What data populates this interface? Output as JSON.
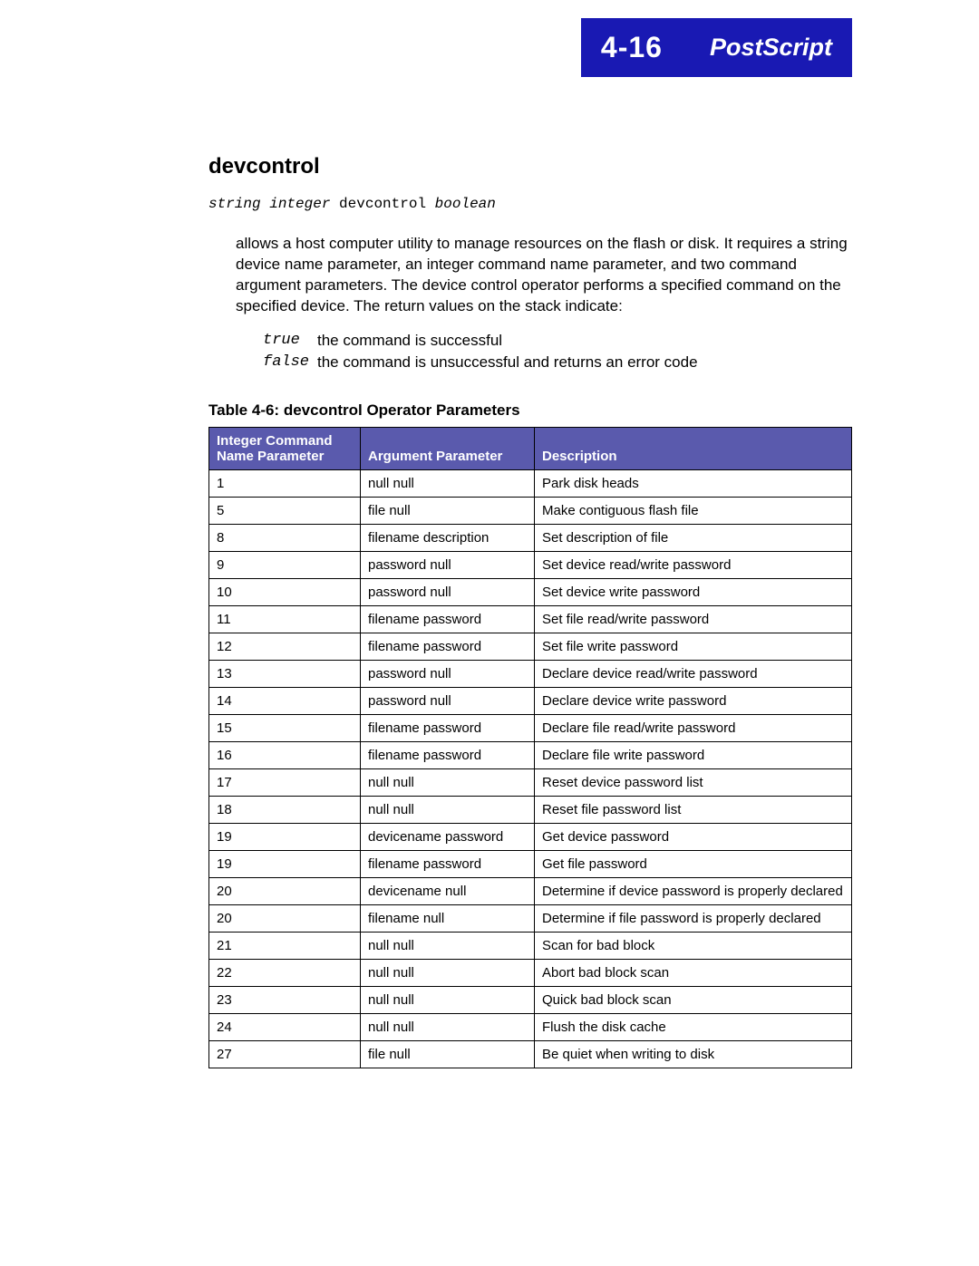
{
  "header": {
    "page_number": "4-16",
    "chapter": "PostScript"
  },
  "section": {
    "title": "devcontrol"
  },
  "signature": {
    "args": "string integer",
    "op": "devcontrol",
    "ret": "boolean"
  },
  "paragraph": "allows a host computer utility to manage resources on the flash or disk. It requires a string device name parameter, an integer command name parameter, and two command argument parameters. The device control operator performs a specified command on the specified device. The return values on the stack indicate:",
  "returns": {
    "true": {
      "key": "true",
      "desc": "the command is successful"
    },
    "false": {
      "key": "false",
      "desc": "the command is unsuccessful and returns an error code"
    }
  },
  "table": {
    "caption": "Table 4-6:  devcontrol Operator Parameters",
    "headers": {
      "c1a": "Integer Command",
      "c1b": "Name Parameter",
      "c2": "Argument Parameter",
      "c3": "Description"
    },
    "rows": [
      {
        "id": "1",
        "arg": "null null",
        "desc": "Park disk heads"
      },
      {
        "id": "5",
        "arg": "file null",
        "desc": "Make contiguous flash file"
      },
      {
        "id": "8",
        "arg": "filename description",
        "desc": "Set description of file"
      },
      {
        "id": "9",
        "arg": "password null",
        "desc": "Set device read/write password"
      },
      {
        "id": "10",
        "arg": "password null",
        "desc": "Set device write password"
      },
      {
        "id": "11",
        "arg": "filename password",
        "desc": "Set file read/write password"
      },
      {
        "id": "12",
        "arg": "filename password",
        "desc": "Set file write password"
      },
      {
        "id": "13",
        "arg": "password null",
        "desc": "Declare device read/write password"
      },
      {
        "id": "14",
        "arg": "password null",
        "desc": "Declare device write password"
      },
      {
        "id": "15",
        "arg": "filename password",
        "desc": "Declare file read/write password"
      },
      {
        "id": "16",
        "arg": "filename password",
        "desc": "Declare file write password"
      },
      {
        "id": "17",
        "arg": "null null",
        "desc": "Reset device password list"
      },
      {
        "id": "18",
        "arg": "null null",
        "desc": "Reset file password list"
      },
      {
        "id": "19",
        "arg": "devicename password",
        "desc": "Get device password"
      },
      {
        "id": "19",
        "arg": "filename password",
        "desc": "Get file password"
      },
      {
        "id": "20",
        "arg": "devicename null",
        "desc": "Determine if device password is properly declared"
      },
      {
        "id": "20",
        "arg": "filename null",
        "desc": "Determine if file password is properly declared"
      },
      {
        "id": "21",
        "arg": "null null",
        "desc": "Scan for bad block"
      },
      {
        "id": "22",
        "arg": "null null",
        "desc": "Abort bad block scan"
      },
      {
        "id": "23",
        "arg": "null null",
        "desc": "Quick bad block scan"
      },
      {
        "id": "24",
        "arg": "null null",
        "desc": "Flush the disk cache"
      },
      {
        "id": "27",
        "arg": "file null",
        "desc": "Be quiet when writing to disk"
      }
    ]
  }
}
